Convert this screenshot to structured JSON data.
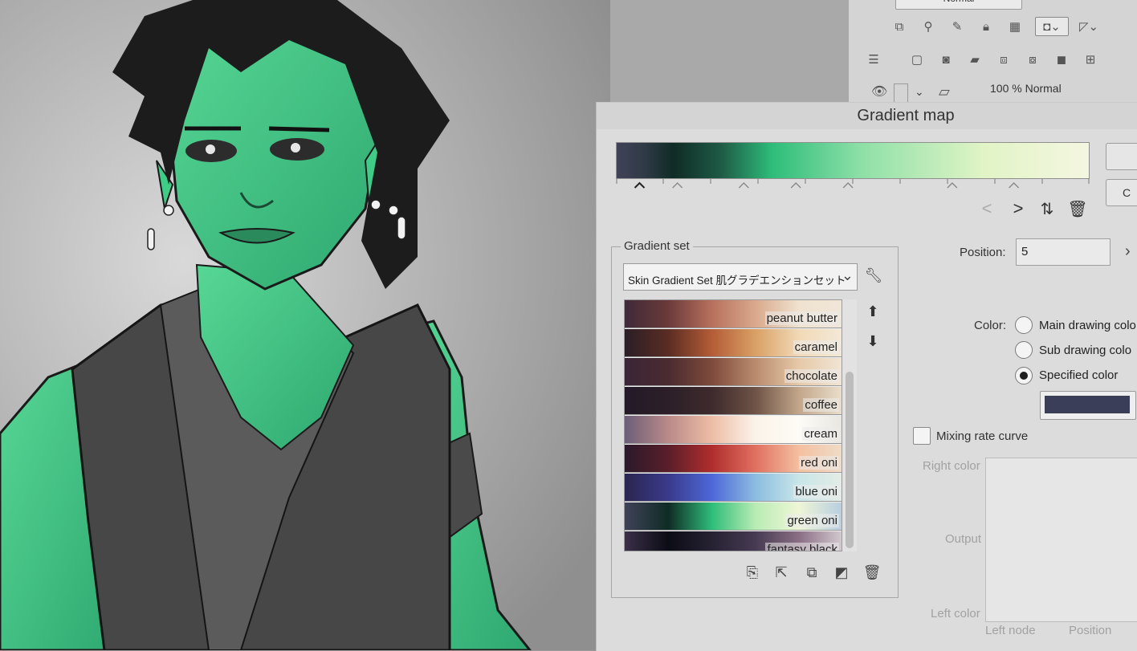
{
  "layer_panel": {
    "blend_mode": "Normal",
    "layer_label": "100 % Normal",
    "toolbar_row1": [
      "clip-icon",
      "reference-icon",
      "draft-icon",
      "lock-icon",
      "lock-alpha-icon",
      "mask-enable-icon",
      "mask-disable-icon"
    ],
    "toolbar_row2": [
      "layer-list-icon",
      "new-raster-layer-icon",
      "new-vector-layer-icon",
      "new-folder-icon",
      "transfer-down-icon",
      "combine-icon",
      "mask-icon",
      "add-icon"
    ]
  },
  "dialog": {
    "title": "Gradient map",
    "side_buttons": [
      "",
      "C"
    ],
    "gradient": {
      "stops": [
        {
          "pos": 0,
          "color": "#404258"
        },
        {
          "pos": 6,
          "color": "#2f3a46"
        },
        {
          "pos": 12,
          "color": "#0f2b25"
        },
        {
          "pos": 22,
          "color": "#1e5a45"
        },
        {
          "pos": 33,
          "color": "#2ebd7a"
        },
        {
          "pos": 52,
          "color": "#8fe0a8"
        },
        {
          "pos": 78,
          "color": "#e2f4c6"
        },
        {
          "pos": 100,
          "color": "#f4f6e1"
        }
      ],
      "node_positions": [
        5,
        13,
        27,
        38,
        49,
        71,
        84
      ],
      "tick_positions": [
        0,
        10,
        20,
        30,
        40,
        50,
        60,
        70,
        80,
        90,
        100
      ]
    },
    "nav_icons": [
      "previous-node-icon",
      "next-node-icon",
      "flip-gradient-icon",
      "delete-node-icon"
    ],
    "gradient_set": {
      "legend": "Gradient set",
      "selected": "Skin Gradient Set 肌グラデエンションセット",
      "items": [
        {
          "label": "peanut butter",
          "colors": [
            "#3e2a38",
            "#6b3a3a",
            "#b7705c",
            "#d9a98c",
            "#efe2cf",
            "#f0e6d8"
          ]
        },
        {
          "label": "caramel",
          "colors": [
            "#2a1e26",
            "#5a2c24",
            "#b45c36",
            "#d9a065",
            "#f1d9b6",
            "#f3e9d8"
          ]
        },
        {
          "label": "chocolate",
          "colors": [
            "#3a2536",
            "#4a2b30",
            "#7e4a3c",
            "#b98b6e",
            "#e6c9a8",
            "#f0e5d5"
          ]
        },
        {
          "label": "coffee",
          "colors": [
            "#231a28",
            "#2c1f28",
            "#3e2a2c",
            "#6e5346",
            "#c2a68a",
            "#eadfcc"
          ]
        },
        {
          "label": "cream",
          "colors": [
            "#6b5e78",
            "#b98a88",
            "#eebda6",
            "#fbf3e9",
            "#fdfcf6",
            "#e8e6e0"
          ]
        },
        {
          "label": "red oni",
          "colors": [
            "#2a1a2a",
            "#5a1e2a",
            "#b02d2d",
            "#e07060",
            "#f4c0a0",
            "#efdcc8"
          ]
        },
        {
          "label": "blue oni",
          "colors": [
            "#2a2650",
            "#3a3a8a",
            "#4d67d8",
            "#8cbce0",
            "#c8e6e8",
            "#e3ece6"
          ]
        },
        {
          "label": "green oni",
          "colors": [
            "#404258",
            "#0f2b25",
            "#2ebd7a",
            "#b8ecb4",
            "#eef6d6",
            "#b8cde0"
          ]
        },
        {
          "label": "fantasy black",
          "colors": [
            "#3a3048",
            "#0c0c16",
            "#262232",
            "#463a52",
            "#8a6e84",
            "#d4cad0"
          ]
        }
      ],
      "bottom_icons": [
        "import-icon",
        "export-icon",
        "duplicate-icon",
        "add-set-icon",
        "trash-icon"
      ]
    },
    "position": {
      "label": "Position:",
      "value": "5"
    },
    "color": {
      "label": "Color:",
      "options": [
        "Main drawing colo",
        "Sub drawing colo",
        "Specified color"
      ],
      "selected_index": 2,
      "specified_swatch": "#3b3e58"
    },
    "mixing": {
      "label": "Mixing rate curve",
      "right_color": "Right color",
      "output": "Output",
      "left_color": "Left color",
      "left_node": "Left node",
      "position_axis": "Position"
    }
  },
  "accent_colors": {
    "skin_green": "#3fcc86",
    "hair": "#1c1c1c"
  }
}
